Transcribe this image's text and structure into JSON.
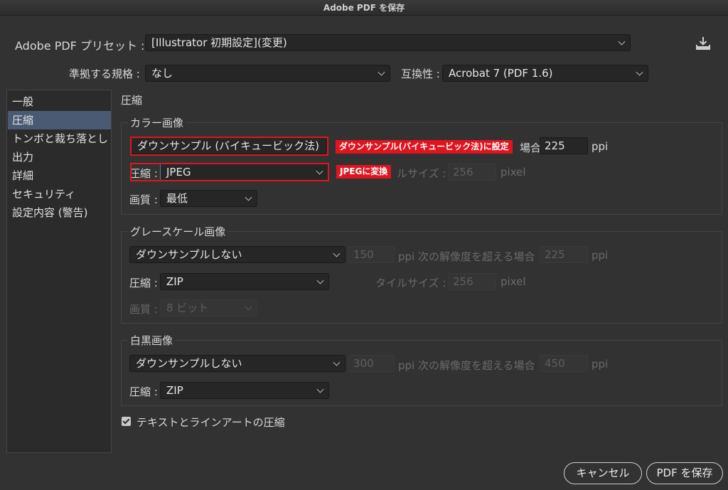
{
  "window": {
    "title": "Adobe PDF を保存"
  },
  "preset": {
    "label": "Adobe PDF プリセット :",
    "value": "[Illustrator 初期設定](変更)",
    "download_icon": "download-icon"
  },
  "standard": {
    "label": "準拠する規格 :",
    "value": "なし"
  },
  "compat": {
    "label": "互換性 :",
    "value": "Acrobat 7 (PDF 1.6)"
  },
  "sidebar": {
    "items": [
      {
        "label": "一般"
      },
      {
        "label": "圧縮"
      },
      {
        "label": "トンボと裁ち落とし"
      },
      {
        "label": "出力"
      },
      {
        "label": "詳細"
      },
      {
        "label": "セキュリティ"
      },
      {
        "label": "設定内容 (警告)"
      }
    ],
    "selected_index": 1
  },
  "section_title": "圧縮",
  "color": {
    "title": "カラー画像",
    "downsample": "ダウンサンプル (バイキュービック法)",
    "ppi_suffix": "ppi",
    "above_ppi": "225",
    "above_label_fragment": "場合",
    "compress_label": "圧縮 :",
    "compress_value": "JPEG",
    "tile_label_fragment": "ルサイズ :",
    "tile_value": "256",
    "tile_unit": "pixel",
    "quality_label": "画質 :",
    "quality_value": "最低"
  },
  "gray": {
    "title": "グレースケール画像",
    "downsample": "ダウンサンプルしない",
    "ppi_value": "150",
    "ppi_text": "ppi 次の解像度を超える場合",
    "above_ppi": "225",
    "ppi_suffix": "ppi",
    "compress_label": "圧縮 :",
    "compress_value": "ZIP",
    "tile_label": "タイルサイズ :",
    "tile_value": "256",
    "tile_unit": "pixel",
    "quality_label": "画質 :",
    "quality_value": "8 ビット"
  },
  "mono": {
    "title": "白黒画像",
    "downsample": "ダウンサンプルしない",
    "ppi_value": "300",
    "ppi_text": "ppi 次の解像度を超える場合",
    "above_ppi": "450",
    "ppi_suffix": "ppi",
    "compress_label": "圧縮 :",
    "compress_value": "ZIP"
  },
  "compress_text": {
    "label": "テキストとラインアートの圧縮",
    "checked": true
  },
  "annotations": {
    "downsample_note": "ダウンサンプル(バイキュービック法)に設定",
    "jpeg_note": "JPEGに変換",
    "color": "#e0141f"
  },
  "buttons": {
    "cancel": "キャンセル",
    "save": "PDF を保存"
  },
  "colors": {
    "background": "#323232",
    "selection": "#4a5a72"
  }
}
